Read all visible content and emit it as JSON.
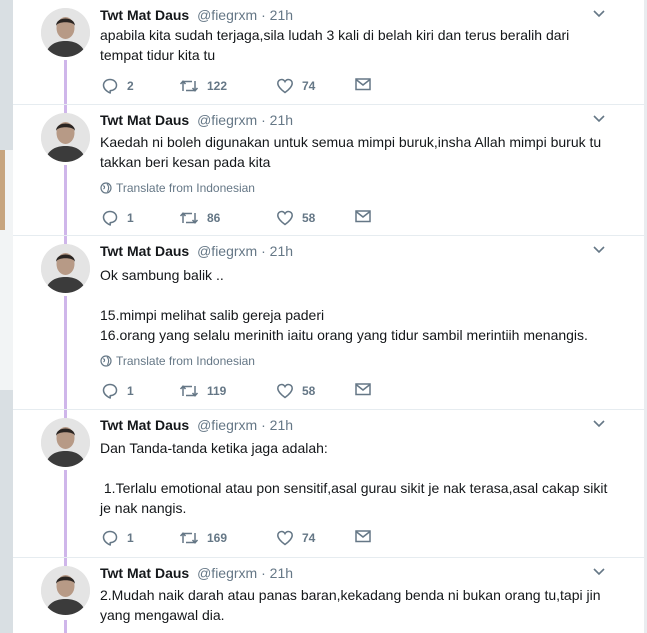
{
  "tweets": [
    {
      "name": "Twt Mat Daus",
      "handle": "@fiegrxm",
      "time": "21h",
      "text": "apabila kita sudah terjaga,sila ludah 3 kali di belah kiri dan terus beralih dari\ntempat tidur kita tu",
      "translate": "",
      "replies": "2",
      "retweets": "122",
      "likes": "74"
    },
    {
      "name": "Twt Mat Daus",
      "handle": "@fiegrxm",
      "time": "21h",
      "text": "Kaedah ni boleh digunakan untuk semua mimpi buruk,insha Allah mimpi buruk tu\ntakkan beri kesan pada kita",
      "translate": "Translate from Indonesian",
      "replies": "1",
      "retweets": "86",
      "likes": "58"
    },
    {
      "name": "Twt Mat Daus",
      "handle": "@fiegrxm",
      "time": "21h",
      "text": "Ok sambung balik ..\n\n15.mimpi melihat salib gereja paderi\n16.orang yang selalu merinith iaitu orang yang tidur sambil merintiih menangis.",
      "translate": "Translate from Indonesian",
      "replies": "1",
      "retweets": "119",
      "likes": "58"
    },
    {
      "name": "Twt Mat Daus",
      "handle": "@fiegrxm",
      "time": "21h",
      "text": "Dan Tanda-tanda ketika jaga adalah:\n\n 1.Terlalu emotional atau pon sensitif,asal gurau sikit je nak terasa,asal cakap sikit\nje nak nangis.",
      "translate": "",
      "replies": "1",
      "retweets": "169",
      "likes": "74"
    },
    {
      "name": "Twt Mat Daus",
      "handle": "@fiegrxm",
      "time": "21h",
      "text": "2.Mudah naik darah atau panas baran,kekadang benda ni bukan orang tu,tapi jin\nyang mengawal dia.",
      "translate": "",
      "replies": "",
      "retweets": "",
      "likes": ""
    }
  ],
  "separator": "·",
  "colors": {
    "thread_line": "#cfb6ea",
    "secondary_text": "#657786",
    "border": "#e6ecf0"
  },
  "icons": [
    "chevron-down-icon",
    "reply-icon",
    "retweet-icon",
    "like-icon",
    "dm-icon",
    "globe-icon"
  ]
}
